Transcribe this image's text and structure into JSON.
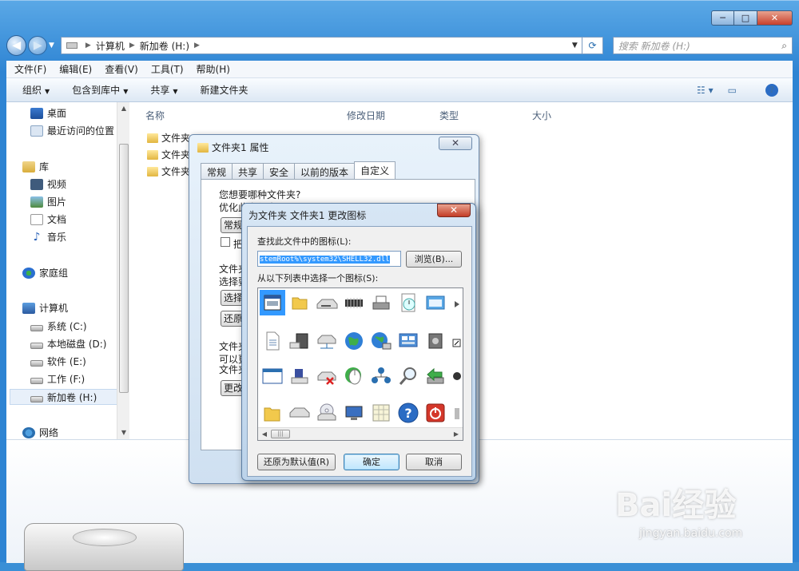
{
  "window": {
    "caption_buttons": [
      "─",
      "□",
      "✕"
    ]
  },
  "address": {
    "segments": [
      "计算机",
      "新加卷 (H:)"
    ],
    "search_placeholder": "搜索 新加卷 (H:)"
  },
  "menu": [
    "文件(F)",
    "编辑(E)",
    "查看(V)",
    "工具(T)",
    "帮助(H)"
  ],
  "toolbar": {
    "organize": "组织",
    "include_library": "包含到库中",
    "share": "共享",
    "new_folder": "新建文件夹"
  },
  "sidebar": {
    "favorites": [
      {
        "label": "桌面",
        "icon": "desktop-icon"
      },
      {
        "label": "最近访问的位置",
        "icon": "recent-places-icon"
      }
    ],
    "library": {
      "label": "库",
      "items": [
        "视频",
        "图片",
        "文档",
        "音乐"
      ]
    },
    "homegroup": "家庭组",
    "computer": {
      "label": "计算机",
      "drives": [
        "系统 (C:)",
        "本地磁盘 (D:)",
        "软件 (E:)",
        "工作 (F:)",
        "新加卷 (H:)"
      ]
    },
    "network": "网络"
  },
  "columns": [
    "名称",
    "修改日期",
    "类型",
    "大小"
  ],
  "files": [
    "文件夹",
    "文件夹",
    "文件夹"
  ],
  "props_dialog": {
    "title": "文件夹1 属性",
    "tabs": [
      "常规",
      "共享",
      "安全",
      "以前的版本",
      "自定义"
    ],
    "active_tab": "自定义",
    "texts": [
      "您想要哪种文件夹?",
      "优化此文件夹(T):",
      "常规",
      "把",
      "文件夹",
      "选择要",
      "选择",
      "还原",
      "文件夹",
      "可以更",
      "文件夹",
      "更改"
    ]
  },
  "icon_dialog": {
    "title": "为文件夹 文件夹1 更改图标",
    "find_label": "查找此文件中的图标(L):",
    "path_value": "stemRoot%\\system32\\SHELL32.dll",
    "browse": "浏览(B)...",
    "list_label": "从以下列表中选择一个图标(S):",
    "restore_default": "还原为默认值(R)",
    "ok": "确定",
    "cancel": "取消"
  },
  "watermark": {
    "text": "Bai经验",
    "sub": "jingyan.baidu.com"
  }
}
